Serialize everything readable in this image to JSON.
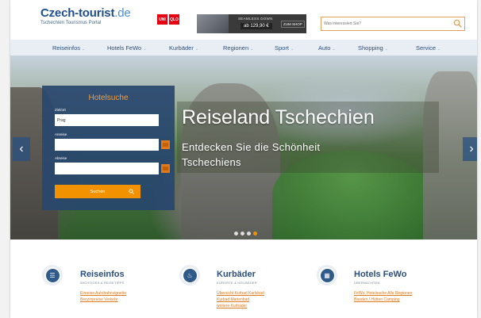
{
  "header": {
    "logo_name": "Czech-tourist",
    "logo_tld": ".de",
    "logo_tagline": "Tschechien Tourismus Portal",
    "ad": {
      "brand_left": "UNI QLO",
      "line1": "SEAMLESS DOWN",
      "price": "ab 129,90 €",
      "shop": "ZUM SHOP"
    },
    "search_placeholder": "Was interessiert Sie?"
  },
  "nav": {
    "items": [
      "Reiseinfos",
      "Hotels FeWo",
      "Kurbäder",
      "Regionen",
      "Sport",
      "Auto",
      "Shopping",
      "Service"
    ]
  },
  "hero": {
    "title": "Reiseland Tschechien",
    "subtitle": "Entdecken Sie die Schönheit Tschechiens",
    "slides": 4,
    "active_slide": 4
  },
  "hotel_search": {
    "title": "Hotelsuche",
    "ziel_label": "Ziel/ort",
    "ziel_value": "Prag",
    "anreise_label": "Anreise",
    "abreise_label": "Abreise",
    "button": "Suchen"
  },
  "features": [
    {
      "title": "Reiseinfos",
      "subtitle": "WICHTIGES & REISETIPPS",
      "links": [
        "Einreise Autobahnvignette",
        "Benzinpreise Verkehr"
      ]
    },
    {
      "title": "Kurbäder",
      "subtitle": "KURORTE & HEILBÄDER",
      "links": [
        "Übersicht Kurbad Karlsbad",
        "Kurbad Marienbad",
        "weitere Kurbäder"
      ]
    },
    {
      "title": "Hotels FeWo",
      "subtitle": "ÜBERNACHTEN",
      "links": [
        "FeWo, Hotelsuche Alle Regionen",
        "Bauden / Hütten Camping"
      ]
    }
  ],
  "colors": {
    "brand_blue": "#1f4e8c",
    "accent_orange": "#f39200"
  }
}
